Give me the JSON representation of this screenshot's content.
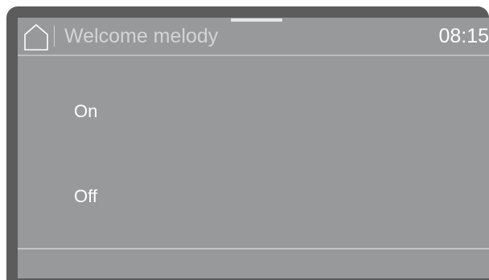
{
  "header": {
    "home_icon": "home-icon",
    "title": "Welcome melody",
    "time": "08:15"
  },
  "options": [
    {
      "label": "On"
    },
    {
      "label": "Off"
    }
  ],
  "colors": {
    "bezel": "#5c5c5d",
    "screen": "#98999b",
    "title_text": "#d3d4d6",
    "text": "#ffffff"
  }
}
